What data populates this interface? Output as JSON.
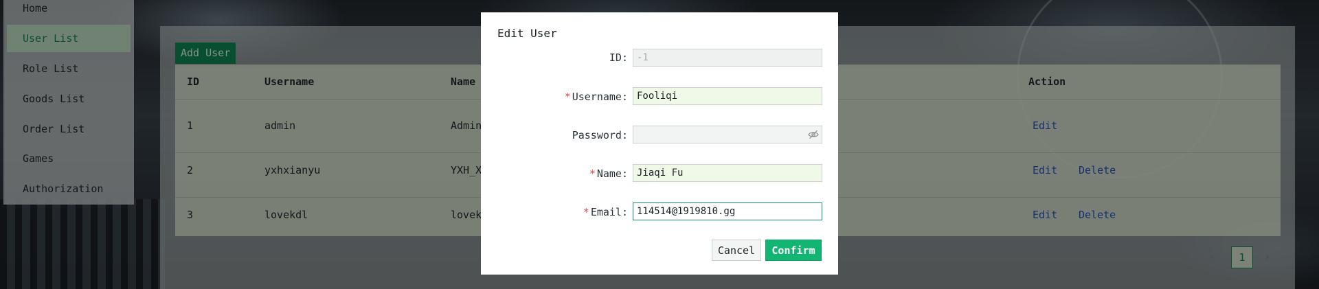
{
  "sidebar": {
    "items": [
      {
        "label": "Home"
      },
      {
        "label": "User List"
      },
      {
        "label": "Role List"
      },
      {
        "label": "Goods List"
      },
      {
        "label": "Order List"
      },
      {
        "label": "Games"
      },
      {
        "label": "Authorization"
      }
    ]
  },
  "toolbar": {
    "add_user_label": "Add User"
  },
  "table": {
    "headers": {
      "id": "ID",
      "username": "Username",
      "name": "Name",
      "action": "Action"
    },
    "rows": [
      {
        "id": "1",
        "username": "admin",
        "name": "Admin"
      },
      {
        "id": "2",
        "username": "yxhxianyu",
        "name": "YXH_X"
      },
      {
        "id": "3",
        "username": "lovekdl",
        "name": "lovek"
      }
    ],
    "edit_label": "Edit",
    "delete_label": "Delete"
  },
  "pagination": {
    "prev": "‹",
    "current_page": "1",
    "next": "›"
  },
  "modal": {
    "title": "Edit User",
    "id_label": "ID:",
    "id_value": "-1",
    "username_label": "Username:",
    "username_value": "Fooliqi",
    "password_label": "Password:",
    "password_value": "",
    "name_label": "Name:",
    "name_value": "Jiaqi Fu",
    "email_label": "Email:",
    "email_value": "114514@1919810.gg",
    "required_mark": "*",
    "cancel_label": "Cancel",
    "confirm_label": "Confirm"
  },
  "colors": {
    "accent": "#0f8a57",
    "confirm": "#12b672",
    "link": "#2456c9",
    "required": "#e84a4a"
  },
  "icons": {
    "password_toggle": "eye-off-icon"
  }
}
